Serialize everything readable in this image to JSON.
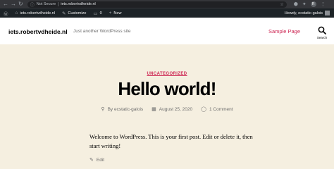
{
  "browser": {
    "security_label": "Not Secure",
    "url": "iets.robertvdheide.nl"
  },
  "admin_bar": {
    "site_link": "iets.robertvdheide.nl",
    "customize": "Customize",
    "comments_count": "0",
    "new_label": "New",
    "howdy": "Howdy, ecstatic-galois"
  },
  "site": {
    "title": "iets.robertvdheide.nl",
    "description": "Just another WordPress site",
    "menu_item": "Sample Page",
    "search_label": "Search"
  },
  "post": {
    "category": "UNCATEGORIZED",
    "title": "Hello world!",
    "author": "By ecstatic-galois",
    "date": "August 25, 2020",
    "comments": "1 Comment",
    "body": "Welcome to WordPress. This is your first post. Edit or delete it, then start writing!",
    "edit_label": "Edit"
  },
  "colors": {
    "accent": "#cd2653",
    "background": "#f5efe0",
    "admin_bar": "#1d2327"
  }
}
